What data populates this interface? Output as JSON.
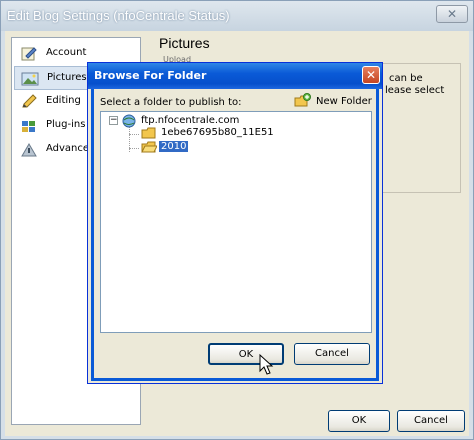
{
  "outer_window": {
    "title": "Edit Blog Settings (nfoCentrale Status)",
    "close_glyph": "✕",
    "sidebar": [
      {
        "label": "Account",
        "icon": "account-icon"
      },
      {
        "label": "Pictures",
        "icon": "pictures-icon",
        "selected": true
      },
      {
        "label": "Editing",
        "icon": "pencil-icon"
      },
      {
        "label": "Plug-ins",
        "icon": "puzzle-icon"
      },
      {
        "label": "Advanced",
        "icon": "advanced-icon"
      }
    ],
    "content_title": "Pictures",
    "content_subtitle": "Upload",
    "bg_text_1": "can be",
    "bg_text_2": "lease select",
    "ok_label": "OK",
    "cancel_label": "Cancel"
  },
  "dialog": {
    "title": "Browse For Folder",
    "close_glyph": "✕",
    "prompt": "Select a folder to publish to:",
    "new_folder_label": "New Folder",
    "expander_glyph": "−",
    "tree": {
      "root": "ftp.nfocentrale.com",
      "children": [
        "1ebe67695b80_11E51",
        "2010"
      ],
      "selected": "2010"
    },
    "ok_label": "OK",
    "cancel_label": "Cancel"
  },
  "colors": {
    "accent": "#0a5ad7",
    "selection": "#316ac5",
    "folder": "#f2c64d"
  }
}
